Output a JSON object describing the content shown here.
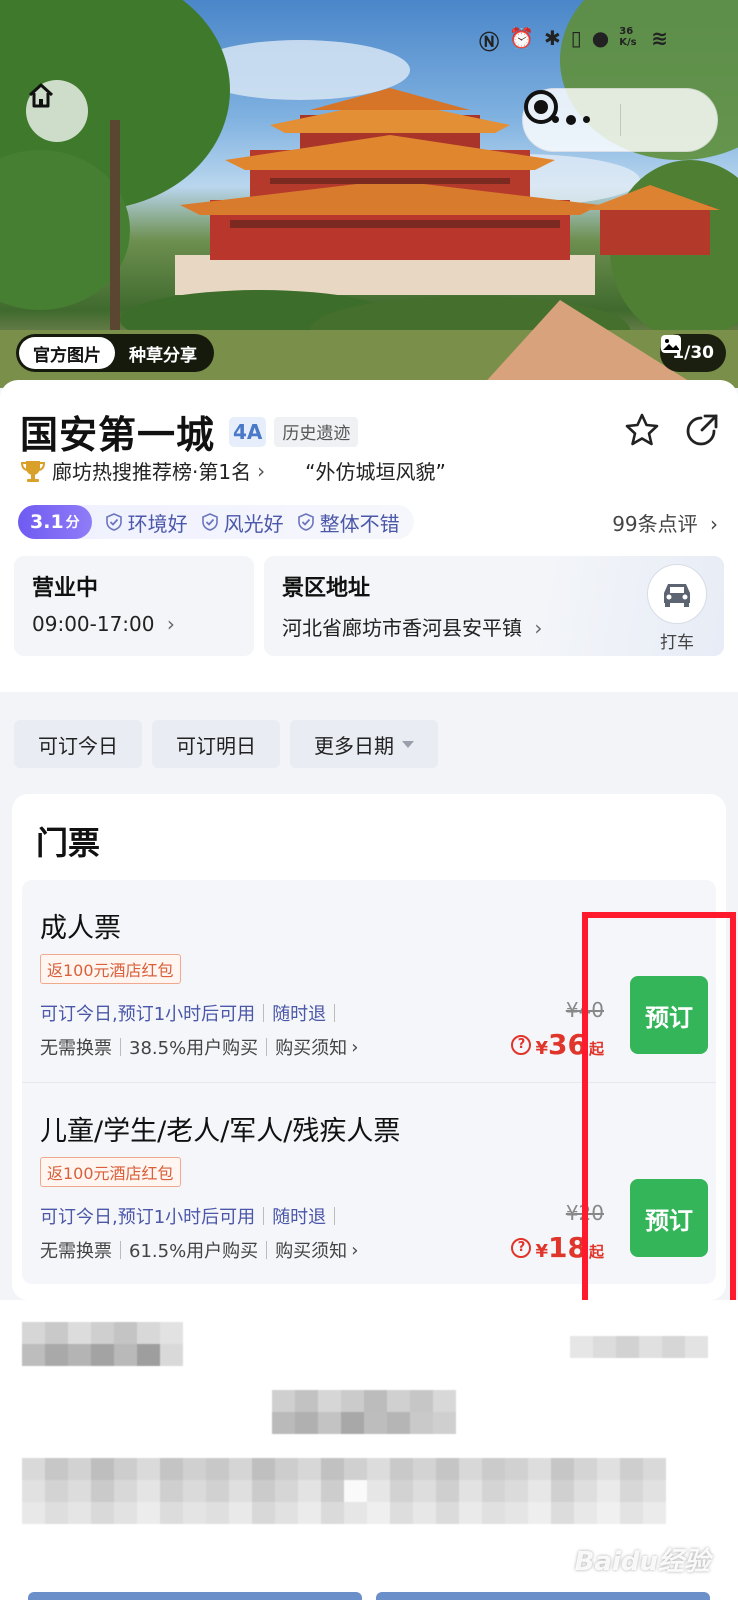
{
  "hero": {
    "home_icon": "home-icon",
    "menu_icon": "more-dots-icon",
    "close_icon": "target-circle-icon",
    "photo_tabs": [
      "官方图片",
      "种草分享"
    ],
    "photo_counter": "1/30"
  },
  "status_bar": {
    "network": "36 K/s"
  },
  "attraction": {
    "name": "国安第一城",
    "level": "4A",
    "category": "历史遗迹",
    "rank_text": "廊坊热搜推荐榜·第1名",
    "quote": "“外仿城垣风貌”",
    "score": "3.1",
    "score_unit": "分",
    "tags": [
      "环境好",
      "风光好",
      "整体不错"
    ],
    "reviews": "99条点评"
  },
  "hours": {
    "title": "营业中",
    "value": "09:00-17:00"
  },
  "address": {
    "title": "景区地址",
    "value": "河北省廊坊市香河县安平镇",
    "taxi_label": "打车"
  },
  "date_filters": [
    "可订今日",
    "可订明日",
    "更多日期"
  ],
  "tickets": {
    "heading": "门票",
    "items": [
      {
        "name": "成人票",
        "badge": "返100元酒店红包",
        "info1": [
          "可订今日,预订1小时后可用",
          "随时退"
        ],
        "info2": [
          "无需换票",
          "38.5%用户购买",
          "购买须知"
        ],
        "original_price": "¥40",
        "currency": "¥",
        "price": "36",
        "price_suffix": "起",
        "book_label": "预订"
      },
      {
        "name": "儿童/学生/老人/军人/残疾人票",
        "badge": "返100元酒店红包",
        "info1": [
          "可订今日,预订1小时后可用",
          "随时退"
        ],
        "info2": [
          "无需换票",
          "61.5%用户购买",
          "购买须知"
        ],
        "original_price": "¥20",
        "currency": "¥",
        "price": "18",
        "price_suffix": "起",
        "book_label": "预订"
      }
    ]
  },
  "watermark": "Baidu经验",
  "colors": {
    "book": "#34b55a",
    "price": "#e0352b",
    "highlight": "#ff1a2e",
    "score": "#6f5bf2"
  }
}
